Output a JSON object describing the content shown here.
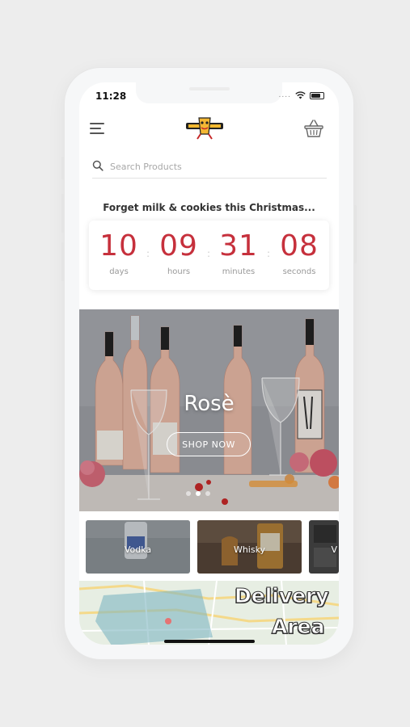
{
  "status": {
    "time": "11:28",
    "signal": "...."
  },
  "header": {
    "menu_icon": "hamburger-menu-icon",
    "logo": "store-logo",
    "basket_icon": "shopping-basket-icon"
  },
  "search": {
    "placeholder": "Search Products",
    "icon": "search-icon"
  },
  "promo": {
    "text": "Forget milk & cookies this Christmas..."
  },
  "countdown": {
    "units": [
      {
        "value": "10",
        "label": "days"
      },
      {
        "value": "09",
        "label": "hours"
      },
      {
        "value": "31",
        "label": "minutes"
      },
      {
        "value": "08",
        "label": "seconds"
      }
    ],
    "separator": ":",
    "number_color": "#c6303c"
  },
  "hero": {
    "title": "Rosè",
    "button": "SHOP NOW",
    "active_slide": 2,
    "slide_count": 3
  },
  "categories": [
    {
      "label": "Vodka"
    },
    {
      "label": "Whisky"
    },
    {
      "label": "V"
    }
  ],
  "map": {
    "line1": "Delivery",
    "line2": "Area"
  }
}
